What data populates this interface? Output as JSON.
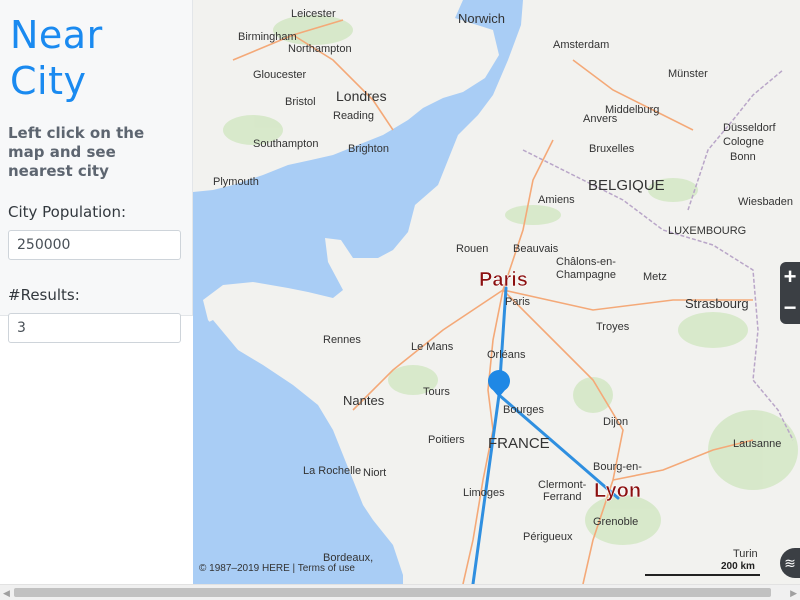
{
  "sidebar": {
    "title": "Near City",
    "instructions": "Left click on the map and see nearest city",
    "population_label": "City Population:",
    "population_value": "250000",
    "results_label": "#Results:",
    "results_value": "3"
  },
  "map": {
    "copyright": "© 1987–2019 HERE | Terms of use",
    "scale_label": "200 km",
    "zoom_in": "+",
    "zoom_out": "−",
    "result_labels": [
      "Paris",
      "Lyon"
    ],
    "colors": {
      "water": "#a9cdf5",
      "land": "#f2f2ef",
      "route": "#2f8fe0",
      "result_text": "#8b1010"
    }
  }
}
